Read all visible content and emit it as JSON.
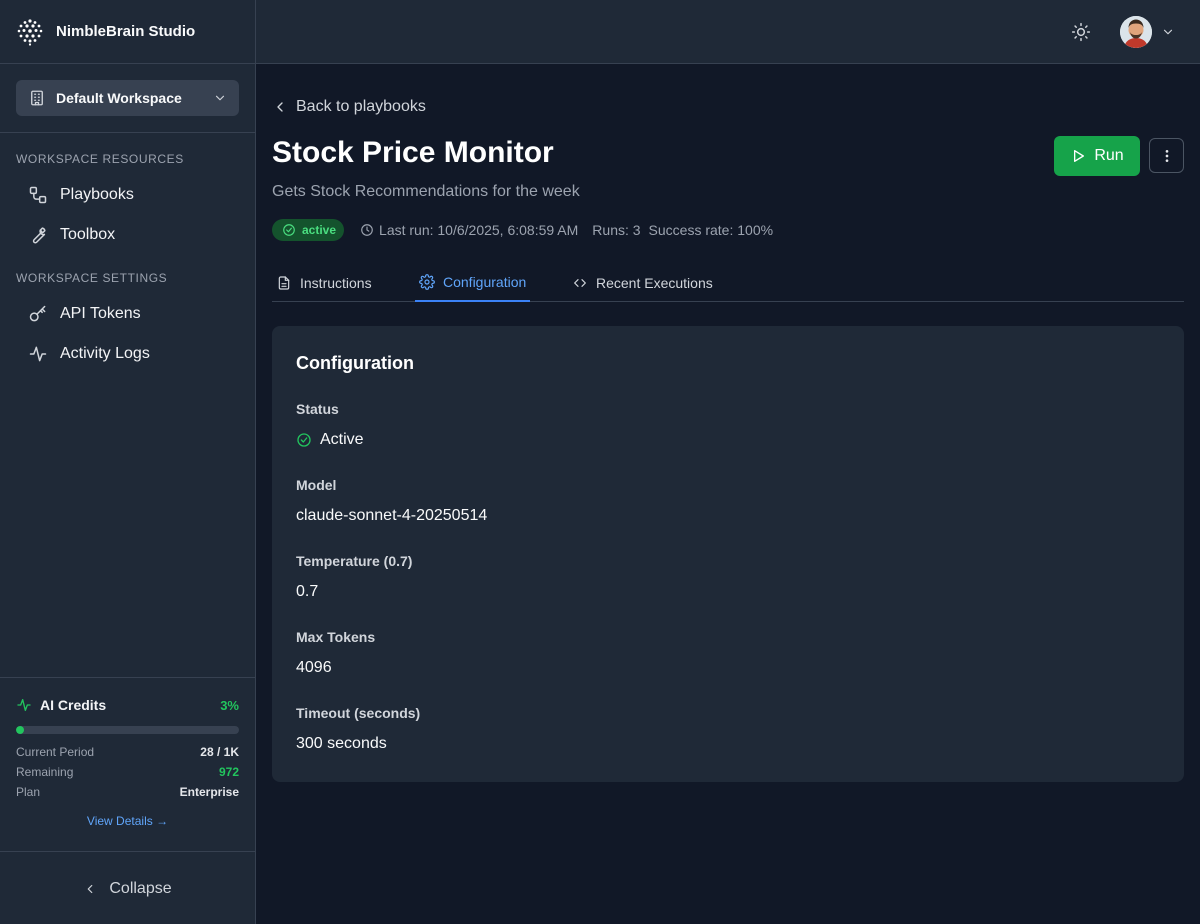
{
  "brand": {
    "name": "NimbleBrain Studio"
  },
  "workspace": {
    "selected": "Default Workspace"
  },
  "sidebar": {
    "resources_title": "WORKSPACE RESOURCES",
    "resources": [
      {
        "label": "Playbooks",
        "icon": "playbooks-icon"
      },
      {
        "label": "Toolbox",
        "icon": "wrench-icon"
      }
    ],
    "settings_title": "WORKSPACE SETTINGS",
    "settings": [
      {
        "label": "API Tokens",
        "icon": "key-icon"
      },
      {
        "label": "Activity Logs",
        "icon": "activity-icon"
      }
    ],
    "collapse_label": "Collapse"
  },
  "credits": {
    "title": "AI Credits",
    "percent": "3%",
    "usage_fraction": 0.03,
    "rows": [
      {
        "key": "Current Period",
        "value": "28 / 1K"
      },
      {
        "key": "Remaining",
        "value": "972"
      },
      {
        "key": "Plan",
        "value": "Enterprise"
      }
    ],
    "view_details": "View Details →"
  },
  "page": {
    "back_label": "Back to playbooks",
    "title": "Stock Price Monitor",
    "subtitle": "Gets Stock Recommendations for the week",
    "run_label": "Run",
    "status_badge": "active",
    "last_run": "Last run: 10/6/2025, 6:08:59 AM",
    "runs": "Runs: 3",
    "success_rate": "Success rate: 100%"
  },
  "tabs": [
    {
      "label": "Instructions",
      "icon": "document-icon",
      "active": false
    },
    {
      "label": "Configuration",
      "icon": "gear-icon",
      "active": true
    },
    {
      "label": "Recent Executions",
      "icon": "code-icon",
      "active": false
    }
  ],
  "config": {
    "title": "Configuration",
    "fields": [
      {
        "label": "Status",
        "value": "Active"
      },
      {
        "label": "Model",
        "value": "claude-sonnet-4-20250514"
      },
      {
        "label": "Temperature (0.7)",
        "value": "0.7"
      },
      {
        "label": "Max Tokens",
        "value": "4096"
      },
      {
        "label": "Timeout (seconds)",
        "value": "300 seconds"
      }
    ]
  },
  "colors": {
    "accent_green": "#16a34a",
    "active_tab": "#60a5fa",
    "background": "#111827",
    "panel": "#1f2937"
  }
}
